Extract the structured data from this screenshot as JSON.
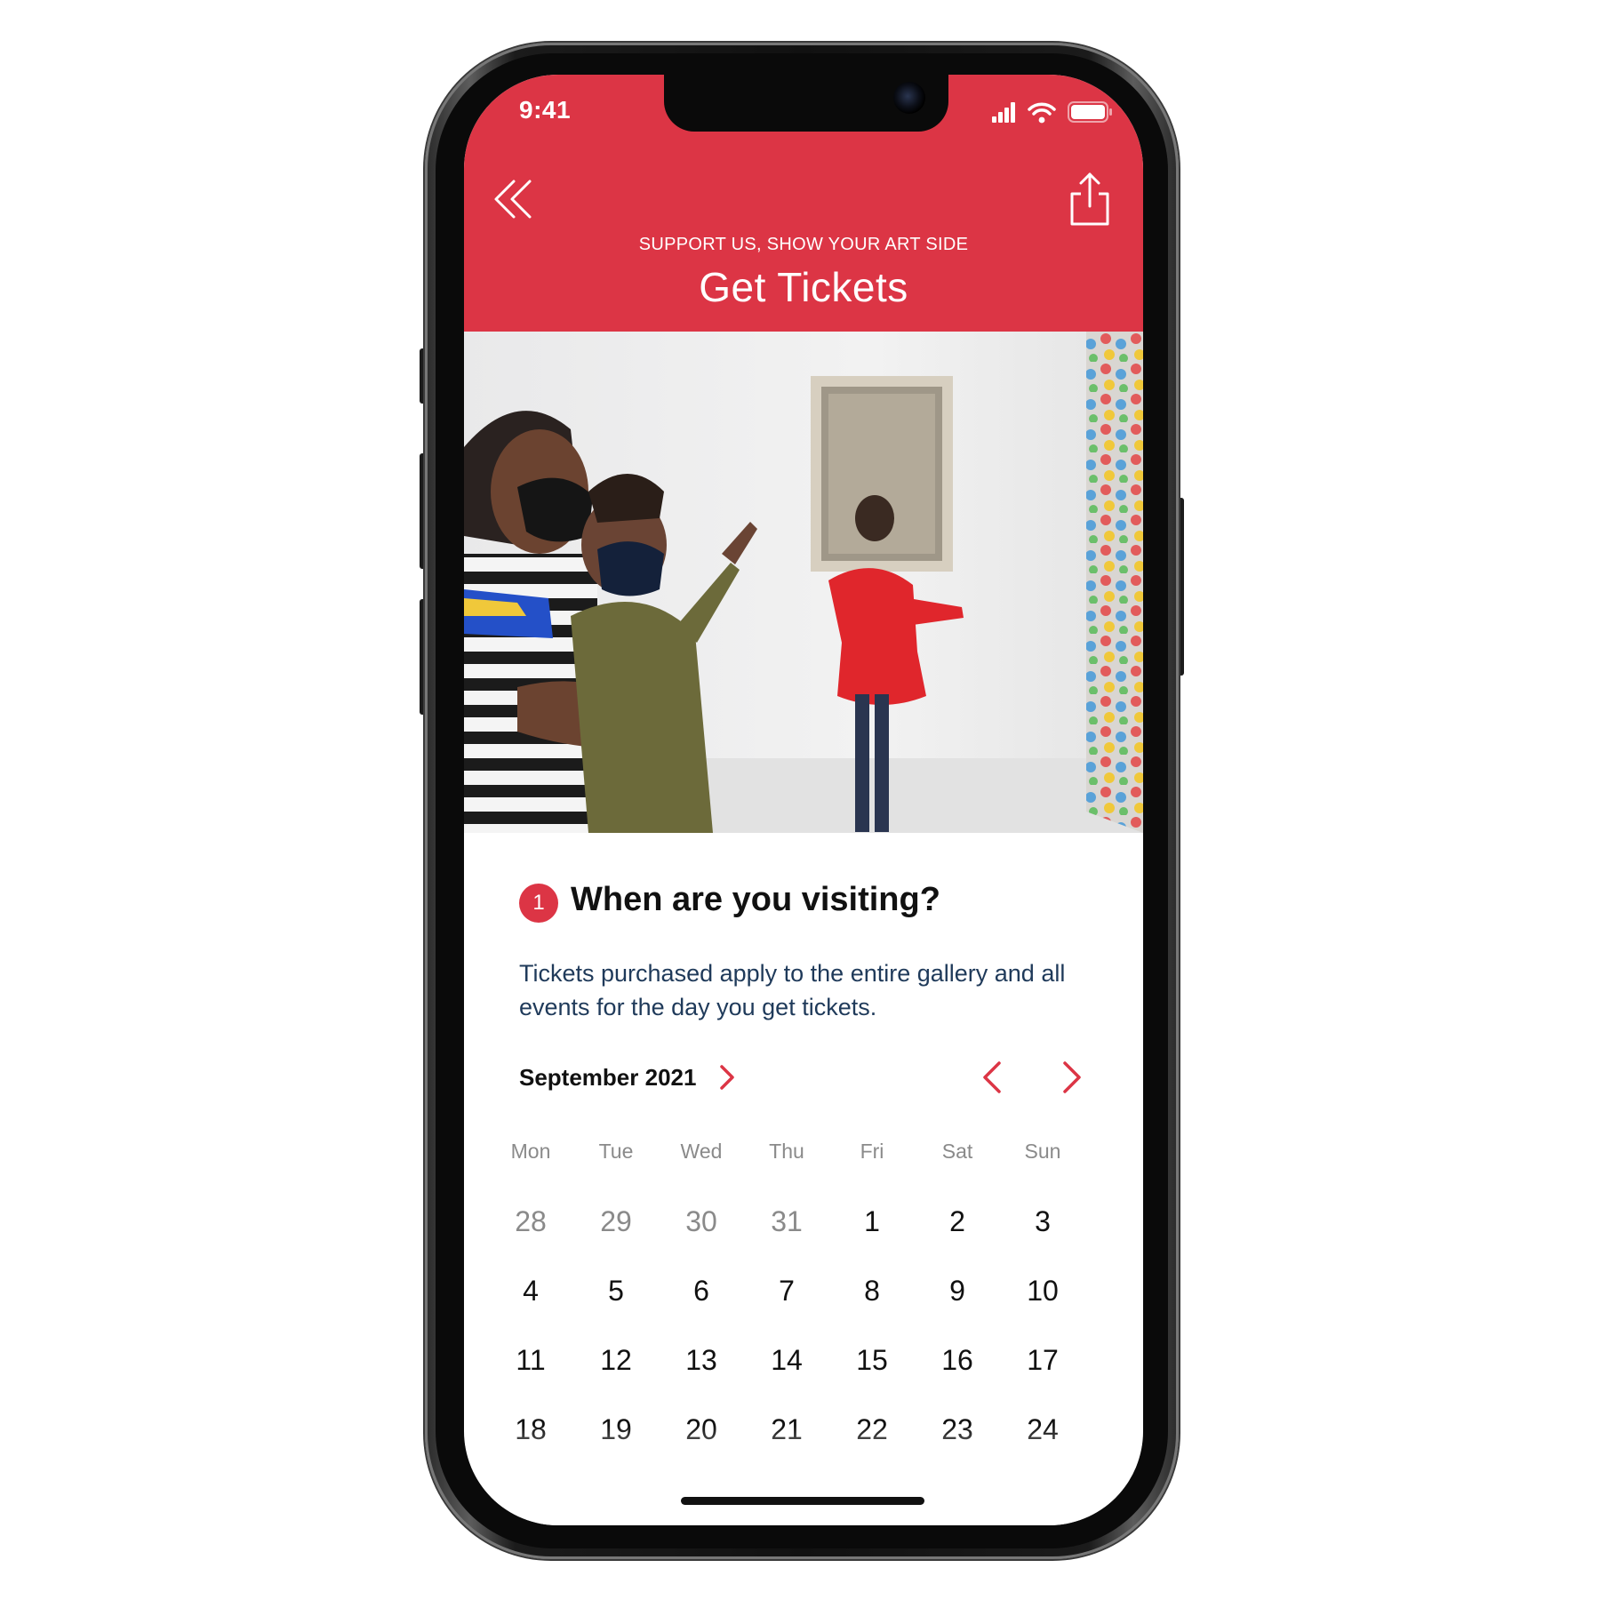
{
  "status_bar": {
    "time": "9:41"
  },
  "header": {
    "subtitle": "SUPPORT US, SHOW YOUR ART SIDE",
    "title": "Get Tickets",
    "color": "#dc3545"
  },
  "step": {
    "number": "1",
    "title": "When are you visiting?",
    "description": "Tickets purchased apply to the entire gallery and all events for the day you get tickets."
  },
  "calendar": {
    "month_label": "September 2021",
    "weekdays": [
      "Mon",
      "Tue",
      "Wed",
      "Thu",
      "Fri",
      "Sat",
      "Sun"
    ],
    "weeks": [
      [
        {
          "d": "28",
          "muted": true
        },
        {
          "d": "29",
          "muted": true
        },
        {
          "d": "30",
          "muted": true
        },
        {
          "d": "31",
          "muted": true
        },
        {
          "d": "1",
          "muted": false
        },
        {
          "d": "2",
          "muted": false
        },
        {
          "d": "3",
          "muted": false
        }
      ],
      [
        {
          "d": "4",
          "muted": false
        },
        {
          "d": "5",
          "muted": false
        },
        {
          "d": "6",
          "muted": false
        },
        {
          "d": "7",
          "muted": false
        },
        {
          "d": "8",
          "muted": false
        },
        {
          "d": "9",
          "muted": false
        },
        {
          "d": "10",
          "muted": false
        }
      ],
      [
        {
          "d": "11",
          "muted": false
        },
        {
          "d": "12",
          "muted": false
        },
        {
          "d": "13",
          "muted": false
        },
        {
          "d": "14",
          "muted": false
        },
        {
          "d": "15",
          "muted": false
        },
        {
          "d": "16",
          "muted": false
        },
        {
          "d": "17",
          "muted": false
        }
      ],
      [
        {
          "d": "18",
          "muted": false
        },
        {
          "d": "19",
          "muted": false
        },
        {
          "d": "20",
          "muted": false
        },
        {
          "d": "21",
          "muted": false
        },
        {
          "d": "22",
          "muted": false
        },
        {
          "d": "23",
          "muted": false
        },
        {
          "d": "24",
          "muted": false
        }
      ]
    ]
  },
  "icons": {
    "back": "double-chevron-left-icon",
    "share": "share-icon",
    "month_expand": "chevron-right-icon",
    "prev": "chevron-left-icon",
    "next": "chevron-right-icon",
    "signal": "cellular-signal-icon",
    "wifi": "wifi-icon",
    "battery": "battery-icon"
  },
  "colors": {
    "accent": "#dc3545",
    "text": "#111111",
    "muted": "#8a8a8a",
    "description": "#1f3a5a"
  }
}
